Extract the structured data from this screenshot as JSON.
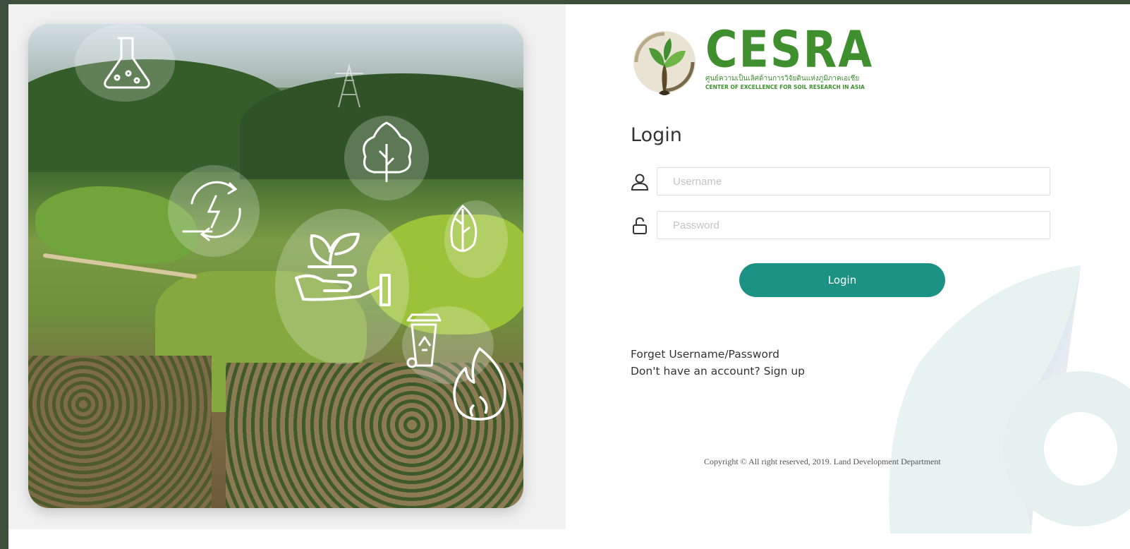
{
  "brand": {
    "name": "CESRA",
    "thai_name": "ศูนย์ความเป็นเลิศด้านการวิจัยดินแห่งภูมิภาคเอเชีย",
    "subtitle": "CENTER OF EXCELLENCE FOR SOIL RESEARCH IN ASIA",
    "color": "#3f8f2f"
  },
  "login": {
    "title": "Login",
    "username_placeholder": "Username",
    "password_placeholder": "Password",
    "button_label": "Login",
    "button_color": "#1b9283"
  },
  "links": {
    "forgot": "Forget Username/Password",
    "signup": "Don't have an account? Sign up"
  },
  "footer": {
    "copyright": "Copyright © All right reserved, 2019. Land Development Department"
  },
  "icons": [
    "flask-icon",
    "power-tower-icon",
    "tree-icon",
    "renewable-energy-icon",
    "leaf-icon",
    "plant-in-hand-icon",
    "recycle-bin-icon",
    "fire-icon",
    "user-icon",
    "unlock-icon"
  ]
}
